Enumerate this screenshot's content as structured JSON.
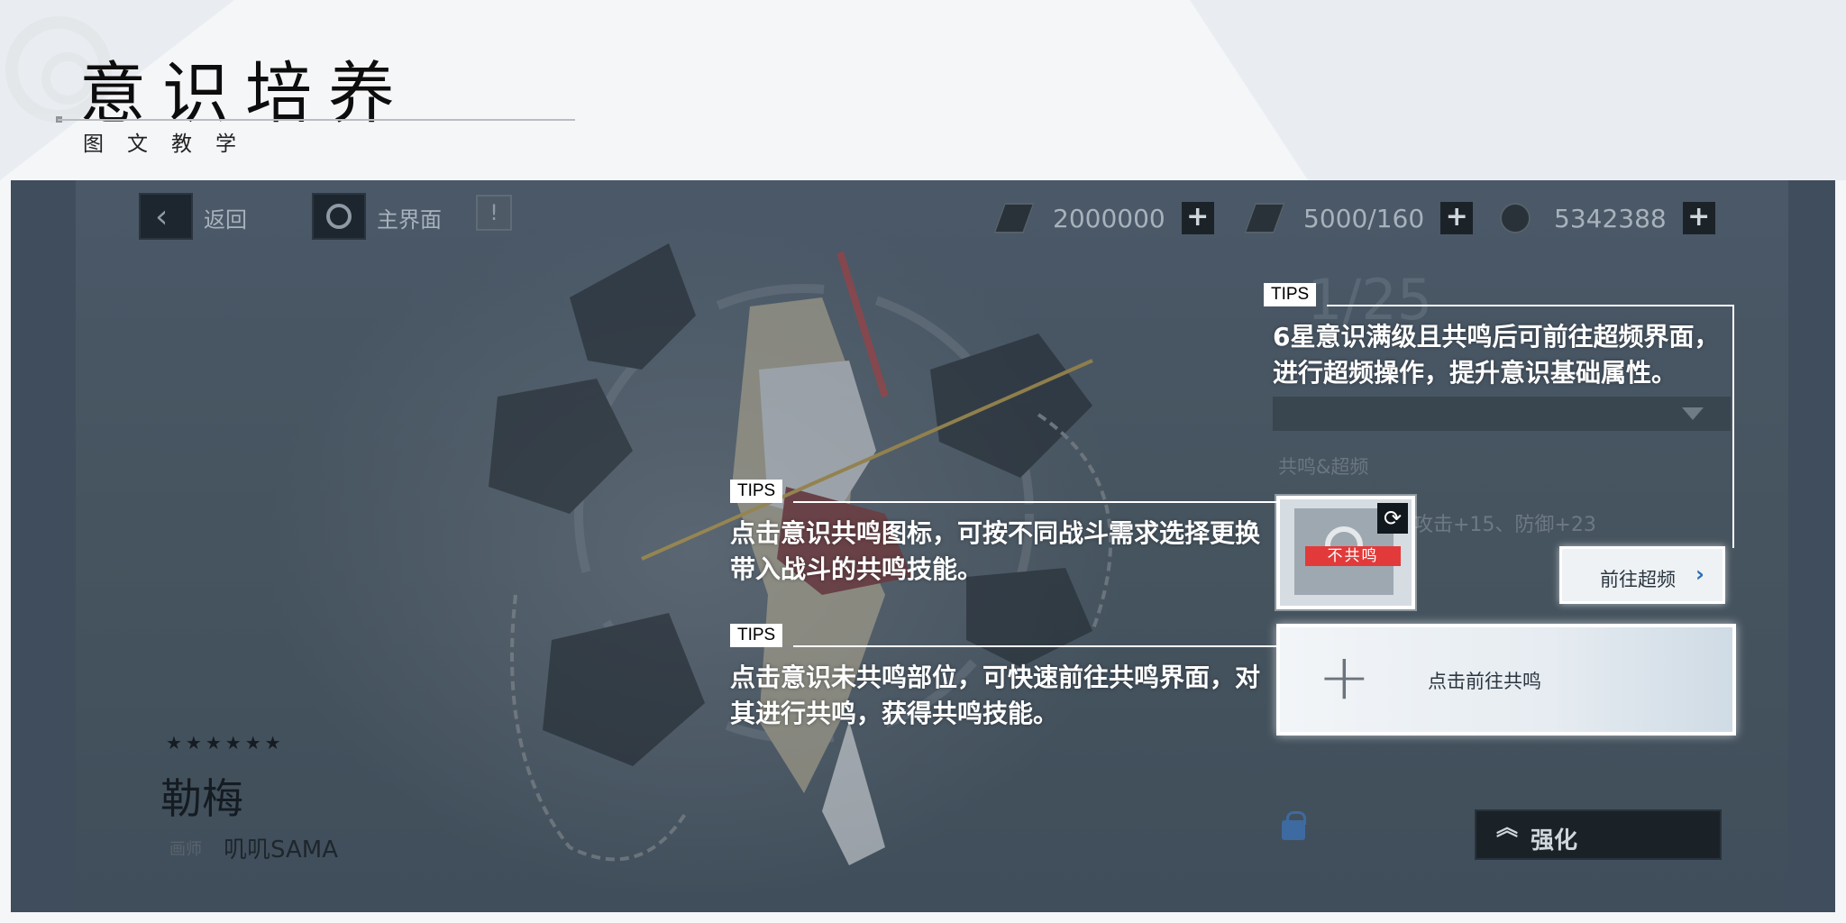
{
  "header": {
    "title": "意识培养",
    "subtitle": "图文教学"
  },
  "topbar": {
    "back_label": "返回",
    "home_label": "主界面",
    "resources": [
      {
        "icon": "ticket-icon",
        "value": "2000000"
      },
      {
        "icon": "stamina-icon",
        "value": "5000/160"
      },
      {
        "icon": "gem-icon",
        "value": "5342388"
      }
    ],
    "plus_label": "+"
  },
  "character": {
    "stars": "★★★★★★",
    "name": "勒梅",
    "artist_label": "画师",
    "artist": "叽叽SAMA"
  },
  "panel": {
    "counter": "1/25",
    "section": "共鸣&超频",
    "stats": "攻击+15、防御+23",
    "resonance_tag": "不共鸣",
    "goto_overclock": "前往超频",
    "goto_resonance": "点击前往共鸣",
    "enhance": "强化"
  },
  "tips": [
    {
      "tag": "TIPS",
      "text": "6星意识满级且共鸣后可前往超频界面，进行超频操作，提升意识基础属性。"
    },
    {
      "tag": "TIPS",
      "text": "点击意识共鸣图标，可按不同战斗需求选择更换带入战斗的共鸣技能。"
    },
    {
      "tag": "TIPS",
      "text": "点击意识未共鸣部位，可快速前往共鸣界面，对其进行共鸣，获得共鸣技能。"
    }
  ],
  "colors": {
    "overlay": "#3f4d5c",
    "tip_text": "#ffffff",
    "resonance_tag": "#e23a3a",
    "accent_chevron": "#2b6fb8"
  }
}
